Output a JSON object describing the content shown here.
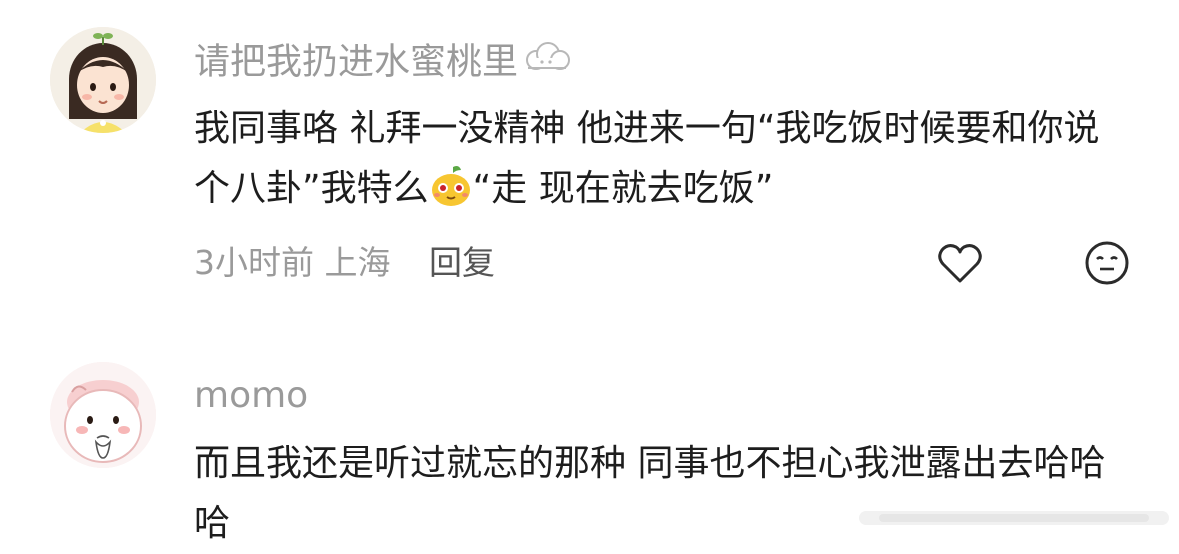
{
  "comments": [
    {
      "username": "请把我扔进水蜜桃里",
      "username_emoji": "cloud-icon",
      "text_before_emoji": "我同事咯 礼拜一没精神 他进来一句“我吃饭时候要和你说个八卦”我特么",
      "inline_emoji": "mango-face-emoji",
      "text_after_emoji": "“走 现在就去吃饭”",
      "time": "3小时前",
      "location": "上海",
      "reply_label": "回复",
      "like_icon": "heart-icon",
      "react_icon": "meh-face-icon"
    },
    {
      "username": "momo",
      "text": "而且我还是听过就忘的那种 同事也不担心我泄露出去哈哈哈"
    }
  ],
  "colors": {
    "username": "#9a9a9a",
    "body_text": "#1d1d1d",
    "meta": "#9a9a9a",
    "reply": "#555555"
  }
}
